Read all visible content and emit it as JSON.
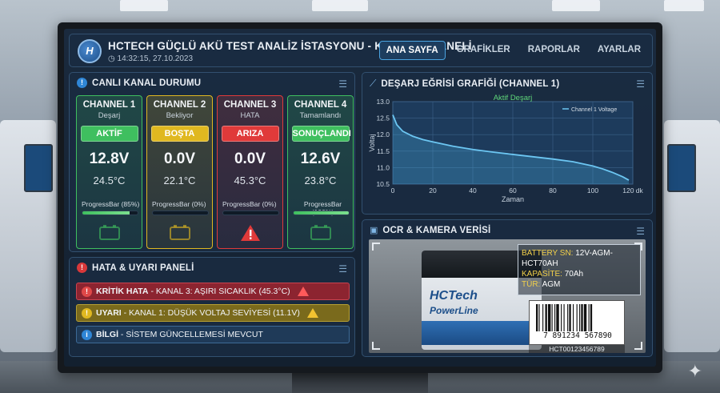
{
  "header": {
    "logo_text": "H",
    "title": "HCTECH GÜÇLÜ AKÜ TEST ANALİZ İSTASYONU - KONTROL PANELİ",
    "datetime": "14:32:15, 27.10.2023"
  },
  "nav": [
    {
      "label": "ANA SAYFA",
      "active": true
    },
    {
      "label": "GRAFİKLER",
      "active": false
    },
    {
      "label": "RAPORLAR",
      "active": false
    },
    {
      "label": "AYARLAR",
      "active": false
    }
  ],
  "channels_panel": {
    "title": "CANLI KANAL DURUMU",
    "channels": [
      {
        "name": "CHANNEL 1",
        "state": "Deşarj",
        "badge": "AKTİF",
        "voltage": "12.8V",
        "temperature": "24.5°C",
        "progress_label": "ProgressBar (85%)",
        "progress": 0.85,
        "color": "#3fbf5f",
        "icon": "battery-icon"
      },
      {
        "name": "CHANNEL 2",
        "state": "Bekliyor",
        "badge": "BOŞTA",
        "voltage": "0.0V",
        "temperature": "22.1°C",
        "progress_label": "ProgressBar (0%)",
        "progress": 0.0,
        "color": "#e0b820",
        "icon": "battery-icon"
      },
      {
        "name": "CHANNEL 3",
        "state": "HATA",
        "badge": "ARIZA",
        "voltage": "0.0V",
        "temperature": "45.3°C",
        "progress_label": "ProgressBar (0%)",
        "progress": 0.0,
        "color": "#e03a3a",
        "icon": "warning-icon"
      },
      {
        "name": "CHANNEL 4",
        "state": "Tamamlandı",
        "badge": "SONUÇLANDI",
        "voltage": "12.6V",
        "temperature": "23.8°C",
        "progress_label": "ProgressBar (100%)",
        "progress": 1.0,
        "color": "#3fbf5f",
        "icon": "battery-icon"
      }
    ]
  },
  "alerts_panel": {
    "title": "HATA & UYARI PANELİ",
    "alerts": [
      {
        "level": "KRİTİK HATA",
        "message": " - KANAL 3: AŞIRI SICAKLIK (45.3°C)",
        "color": "#8c2430"
      },
      {
        "level": "UYARI",
        "message": " - KANAL 1: DÜŞÜK VOLTAJ SEVİYESİ (11.1V)",
        "color": "#7a6a1c"
      },
      {
        "level": "BİLGİ",
        "message": " - SİSTEM GÜNCELLEMESİ MEVCUT",
        "color": "#1f3a58"
      }
    ]
  },
  "chart_panel": {
    "title": "DEŞARJ EĞRİSİ GRAFİĞİ (CHANNEL 1)"
  },
  "chart_data": {
    "type": "area",
    "title": "Aktif Deşarj",
    "xlabel": "Zaman",
    "ylabel": "Voltaj",
    "x_unit_label": "120 dk",
    "xlim": [
      0,
      120
    ],
    "ylim": [
      10.5,
      13.0
    ],
    "x_ticks": [
      0,
      20,
      40,
      60,
      80,
      100,
      120
    ],
    "y_ticks": [
      10.5,
      11.0,
      11.5,
      12.0,
      12.5,
      13.0
    ],
    "grid": true,
    "legend_position": "top-right",
    "series": [
      {
        "name": "Channel 1 Voltage",
        "x": [
          0,
          2,
          5,
          10,
          15,
          20,
          30,
          40,
          50,
          60,
          70,
          80,
          90,
          100,
          105,
          110,
          115,
          118
        ],
        "y": [
          12.6,
          12.3,
          12.1,
          11.95,
          11.85,
          11.78,
          11.65,
          11.55,
          11.47,
          11.4,
          11.33,
          11.26,
          11.18,
          11.05,
          10.96,
          10.85,
          10.72,
          10.62
        ]
      }
    ]
  },
  "ocr_panel": {
    "title": "OCR & KAMERA VERİSİ",
    "battery_brand": "HCTech",
    "battery_line": "PowerLine",
    "fields": [
      {
        "label": "BATTERY SN: ",
        "value": "12V-AGM-HCT70AH"
      },
      {
        "label": "KAPASİTE: ",
        "value": "70Ah"
      },
      {
        "label": "TÜR: ",
        "value": "AGM"
      }
    ],
    "barcode_number": "7 891234 567890",
    "barcode_caption": "HCT00123456789"
  }
}
